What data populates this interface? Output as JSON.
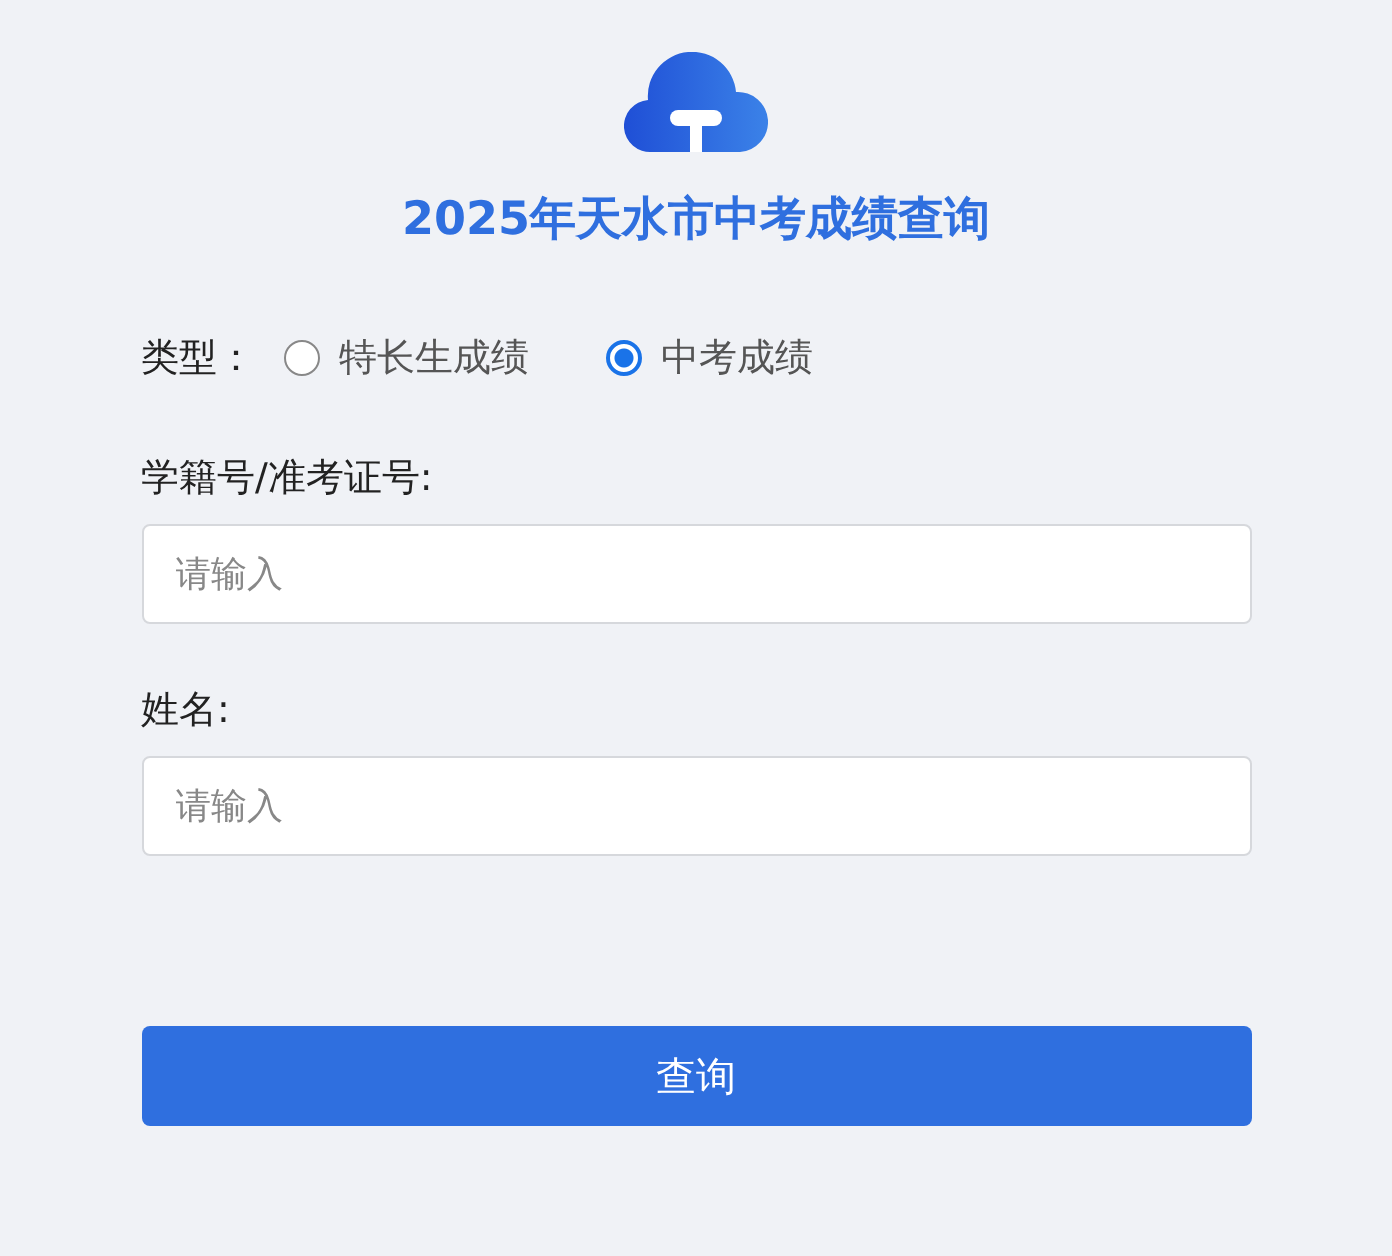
{
  "title": "2025年天水市中考成绩查询",
  "type_field": {
    "label": "类型：",
    "options": [
      {
        "label": "特长生成绩",
        "selected": false
      },
      {
        "label": "中考成绩",
        "selected": true
      }
    ]
  },
  "fields": [
    {
      "label": "学籍号/准考证号:",
      "placeholder": "请输入"
    },
    {
      "label": "姓名:",
      "placeholder": "请输入"
    }
  ],
  "submit": "查询"
}
